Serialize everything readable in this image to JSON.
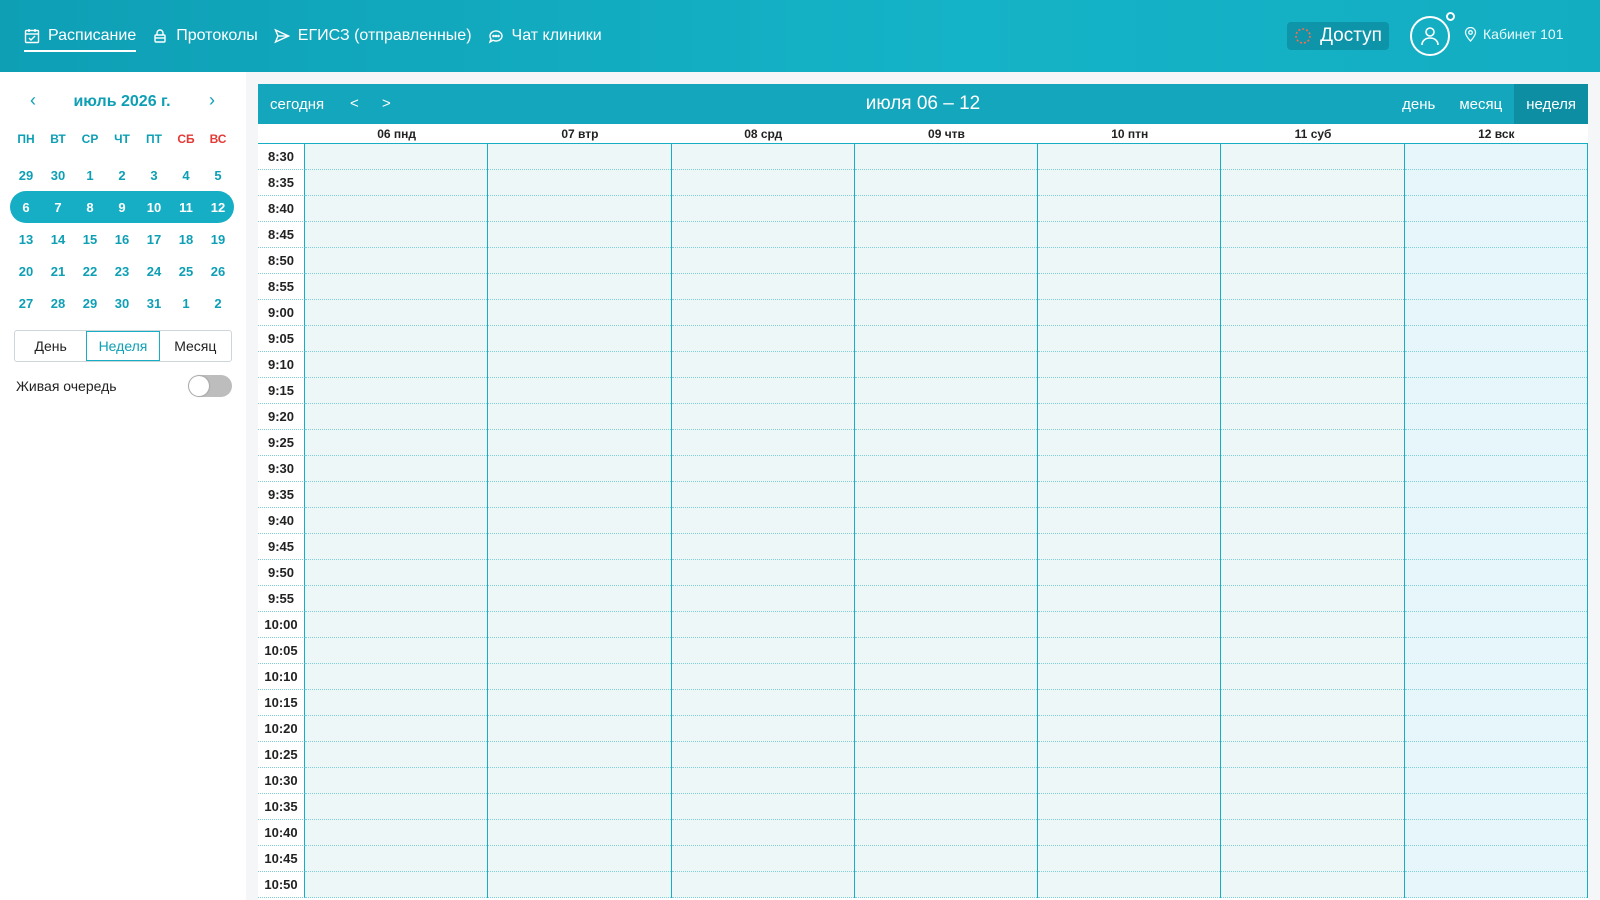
{
  "header": {
    "nav": [
      {
        "label": "Расписание",
        "icon": "calendar-icon",
        "active": true
      },
      {
        "label": "Протоколы",
        "icon": "lock-icon",
        "active": false
      },
      {
        "label": "ЕГИСЗ (отправленные)",
        "icon": "send-icon",
        "active": false
      },
      {
        "label": "Чат клиники",
        "icon": "chat-icon",
        "active": false
      }
    ],
    "access_label": "Доступ",
    "location": "Кабинет 101"
  },
  "mini_calendar": {
    "prev": "‹",
    "next": "›",
    "title": "июль 2026 г.",
    "dow": [
      "ПН",
      "ВТ",
      "СР",
      "ЧТ",
      "ПТ",
      "СБ",
      "ВС"
    ],
    "weeks": [
      [
        "29",
        "30",
        "1",
        "2",
        "3",
        "4",
        "5"
      ],
      [
        "6",
        "7",
        "8",
        "9",
        "10",
        "11",
        "12"
      ],
      [
        "13",
        "14",
        "15",
        "16",
        "17",
        "18",
        "19"
      ],
      [
        "20",
        "21",
        "22",
        "23",
        "24",
        "25",
        "26"
      ],
      [
        "27",
        "28",
        "29",
        "30",
        "31",
        "1",
        "2"
      ]
    ],
    "selected_week": 1
  },
  "view_switch": [
    "День",
    "Неделя",
    "Месяц"
  ],
  "view_switch_active": 1,
  "live_queue": {
    "label": "Живая очередь",
    "enabled": false
  },
  "calendar": {
    "today_label": "сегодня",
    "prev": "<",
    "next": ">",
    "title": "июля 06 – 12",
    "views": [
      "день",
      "месяц",
      "неделя"
    ],
    "active_view": 2,
    "days": [
      "06 пнд",
      "07 втр",
      "08 срд",
      "09 чтв",
      "10 птн",
      "11 суб",
      "12 вск"
    ],
    "today_index": 6,
    "times": [
      "8:30",
      "8:35",
      "8:40",
      "8:45",
      "8:50",
      "8:55",
      "9:00",
      "9:05",
      "9:10",
      "9:15",
      "9:20",
      "9:25",
      "9:30",
      "9:35",
      "9:40",
      "9:45",
      "9:50",
      "9:55",
      "10:00",
      "10:05",
      "10:10",
      "10:15",
      "10:20",
      "10:25",
      "10:30",
      "10:35",
      "10:40",
      "10:45",
      "10:50"
    ]
  },
  "colors": {
    "primary": "#14a6bc",
    "weekend": "#e53935"
  }
}
